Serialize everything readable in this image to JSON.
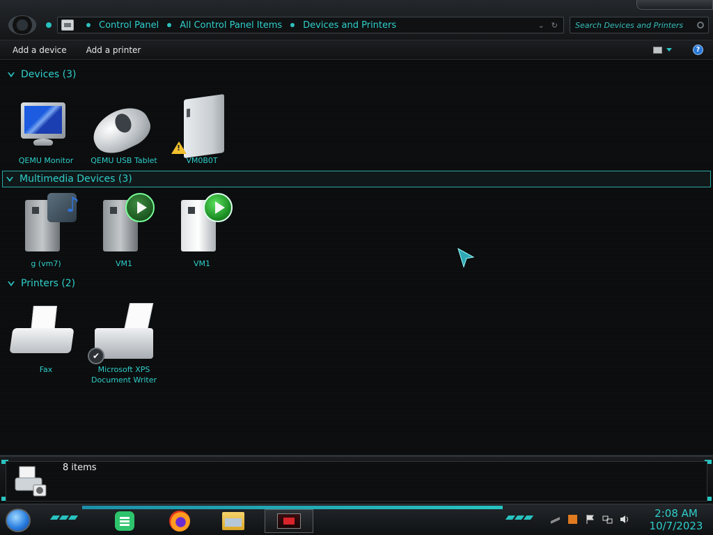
{
  "breadcrumb": {
    "items": [
      "Control Panel",
      "All Control Panel Items",
      "Devices and Printers"
    ]
  },
  "search": {
    "placeholder": "Search Devices and Printers"
  },
  "commandbar": {
    "add_device": "Add a device",
    "add_printer": "Add a printer",
    "help_glyph": "?"
  },
  "groups": {
    "devices": {
      "header": "Devices (3)",
      "items": [
        {
          "label": "QEMU Monitor",
          "icon": "monitor-icon"
        },
        {
          "label": "QEMU USB Tablet",
          "icon": "mouse-icon"
        },
        {
          "label": "VM0B0T",
          "icon": "external-drive-icon"
        }
      ]
    },
    "multimedia": {
      "header": "Multimedia Devices (3)",
      "items": [
        {
          "label": "g (vm7)",
          "icon": "media-server-icon"
        },
        {
          "label": "VM1",
          "icon": "media-player-tower-icon"
        },
        {
          "label": "VM1",
          "icon": "media-player-tower-icon"
        }
      ]
    },
    "printers": {
      "header": "Printers (2)",
      "items": [
        {
          "label": "Fax",
          "icon": "fax-icon"
        },
        {
          "label": "Microsoft XPS Document Writer",
          "icon": "printer-icon"
        }
      ]
    }
  },
  "details": {
    "count": "8 items"
  },
  "taskbar": {
    "apps": [
      "green-notes-app-icon",
      "firefox-icon",
      "file-explorer-icon",
      "control-panel-icon"
    ],
    "clock": {
      "time": "2:08 AM",
      "date": "10/7/2023"
    }
  },
  "colors": {
    "accent": "#2fcfcb",
    "background": "#0a0b0c",
    "text_light": "#e8e8e8"
  }
}
